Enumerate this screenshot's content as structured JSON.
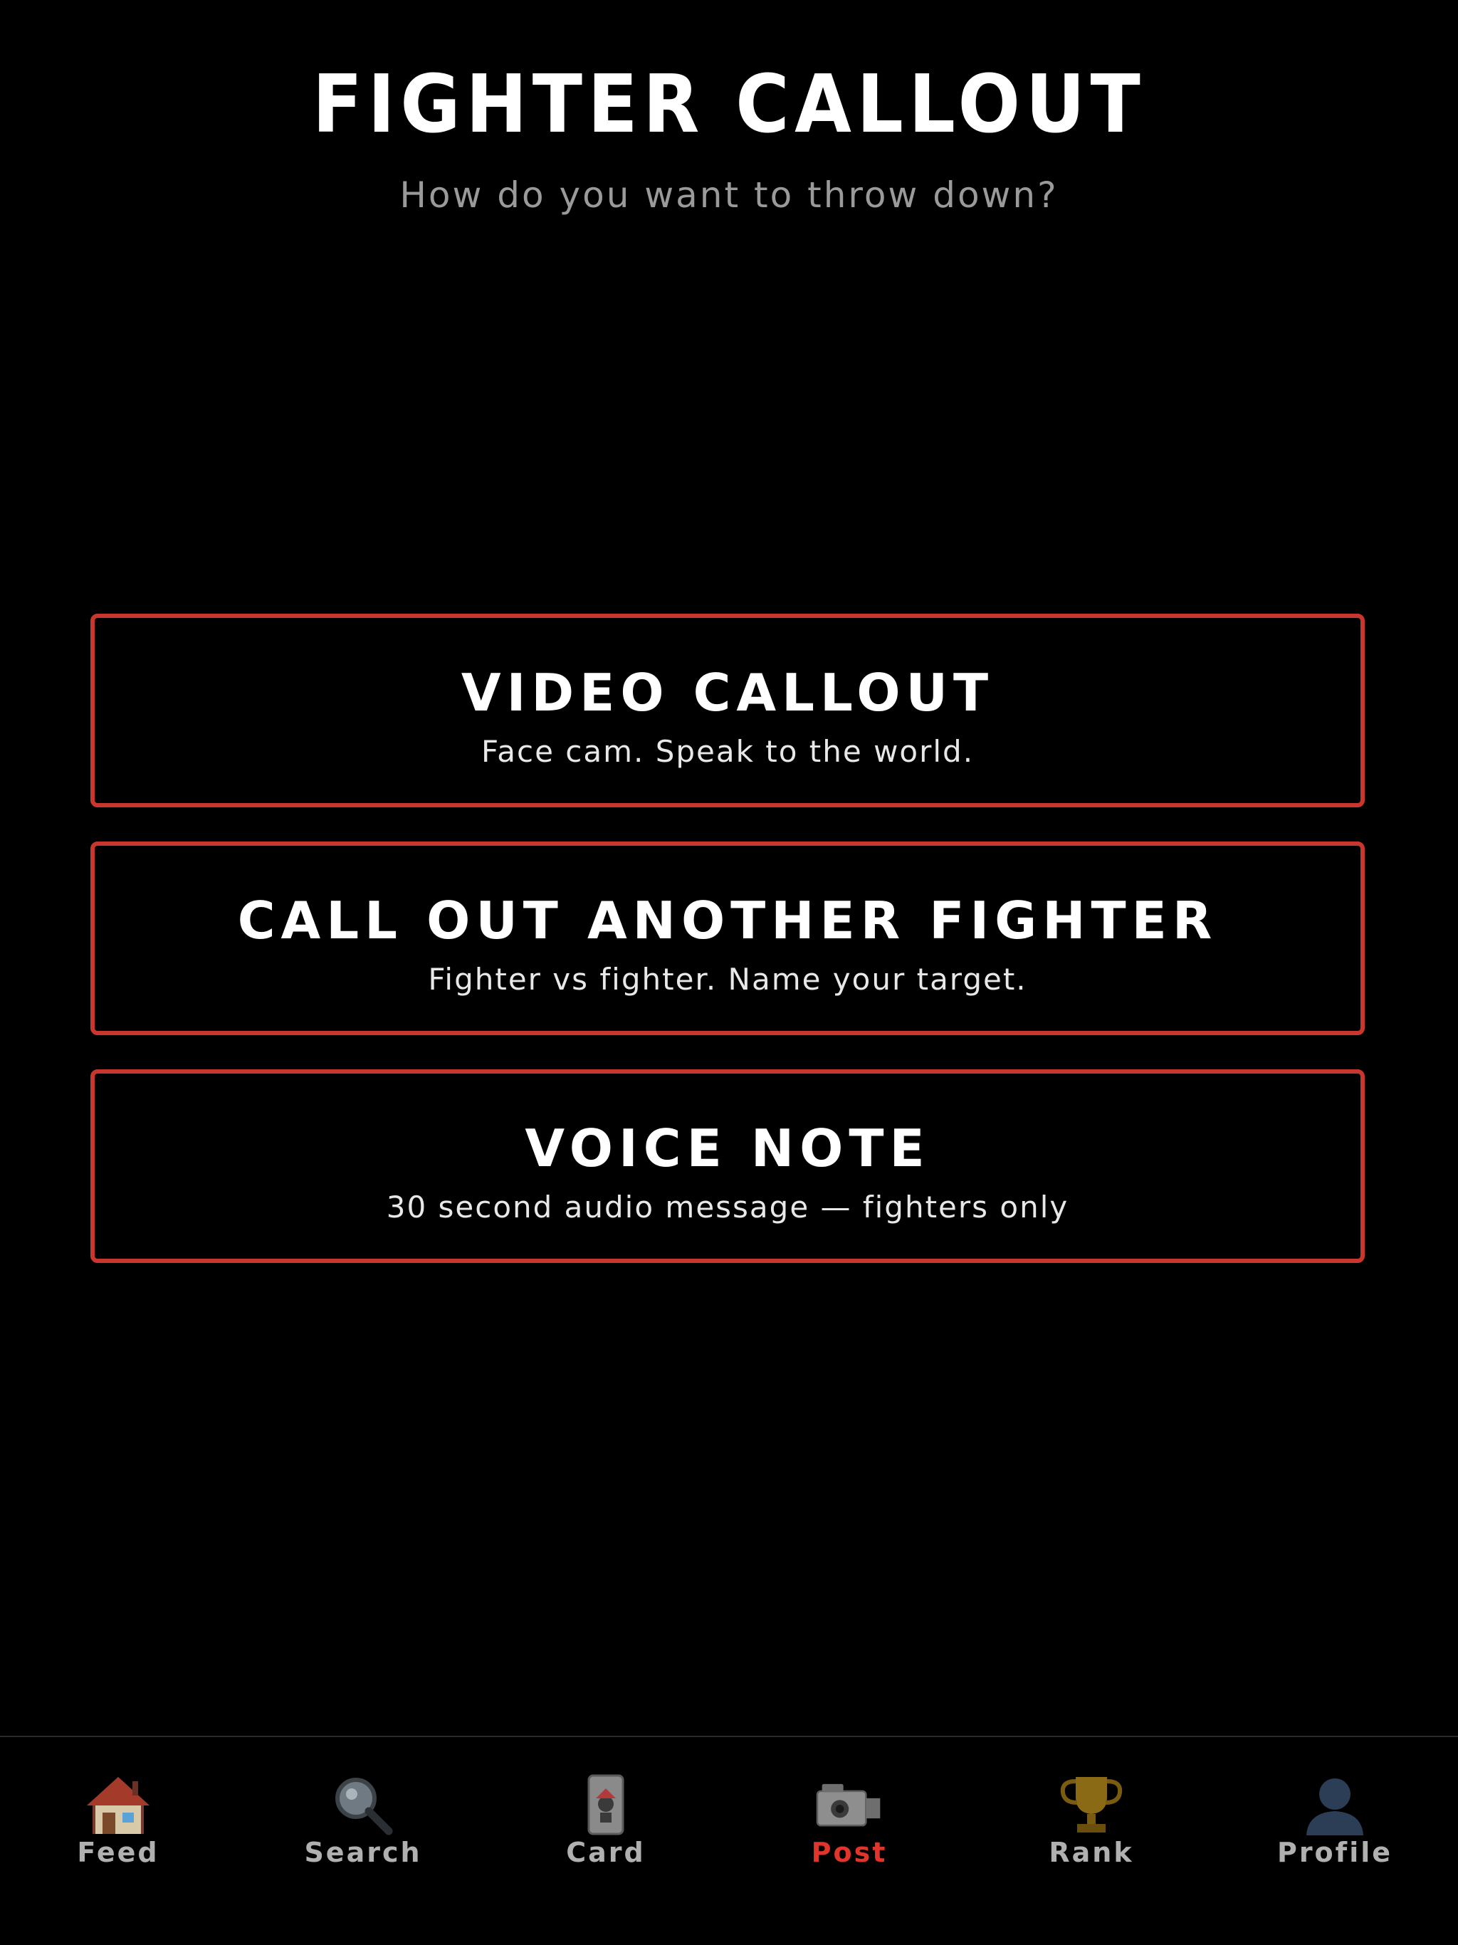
{
  "header": {
    "title": "FIGHTER CALLOUT",
    "subtitle": "How do you want to throw down?"
  },
  "options": [
    {
      "title": "VIDEO CALLOUT",
      "subtitle": "Face cam. Speak to the world."
    },
    {
      "title": "CALL OUT ANOTHER FIGHTER",
      "subtitle": "Fighter vs fighter. Name your target."
    },
    {
      "title": "VOICE NOTE",
      "subtitle": "30 second audio message — fighters only"
    }
  ],
  "tabbar": {
    "active": "Post",
    "items": [
      {
        "label": "Feed",
        "icon": "house-icon"
      },
      {
        "label": "Search",
        "icon": "magnifying-glass-icon"
      },
      {
        "label": "Card",
        "icon": "joker-card-icon"
      },
      {
        "label": "Post",
        "icon": "video-camera-icon"
      },
      {
        "label": "Rank",
        "icon": "trophy-icon"
      },
      {
        "label": "Profile",
        "icon": "person-silhouette-icon"
      }
    ]
  },
  "colors": {
    "background": "#000000",
    "accent_red": "#c8372d",
    "active_tab": "#e0352b",
    "muted_text": "#9a9a9a"
  }
}
